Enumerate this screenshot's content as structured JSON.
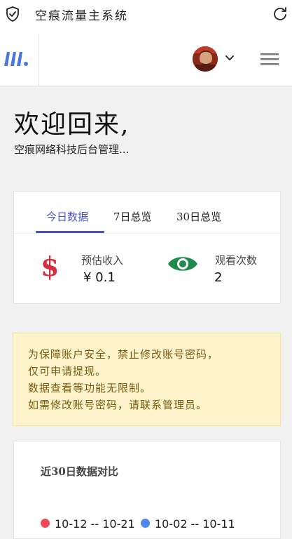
{
  "titlebar": {
    "title": "空痕流量主系统",
    "shield_icon": "shield-check-icon",
    "refresh_icon": "refresh-icon"
  },
  "navbar": {
    "logo_icon": "brand-logo-icon",
    "avatar_icon": "user-avatar",
    "dropdown_icon": "chevron-down-icon",
    "menu_icon": "hamburger-menu-icon"
  },
  "hero": {
    "welcome": "欢迎回来,",
    "subtitle": "空痕网络科技后台管理..."
  },
  "stats": {
    "tabs": [
      {
        "label": "今日数据",
        "active": true
      },
      {
        "label": "7日总览",
        "active": false
      },
      {
        "label": "30日总览",
        "active": false
      }
    ],
    "income": {
      "icon": "dollar-icon",
      "label": "预估收入",
      "value": "¥  0.1",
      "color": "#d32f3f"
    },
    "views": {
      "icon": "eye-icon",
      "label": "观看次数",
      "value": "2",
      "color": "#1e8a4c"
    },
    "accent_color": "#4a55c9"
  },
  "notice": {
    "lines": [
      "为保障账户安全，禁止修改账号密码，",
      "仅可申请提现。",
      "数据查看等功能无限制。",
      "如需修改账号密码，请联系管理员。"
    ]
  },
  "compare": {
    "title": "近30日数据对比",
    "legend": [
      {
        "label": "10-12 -- 10-21",
        "color": "#ef4b55"
      },
      {
        "label": "10-02 -- 10-11",
        "color": "#4f87ee"
      }
    ]
  }
}
